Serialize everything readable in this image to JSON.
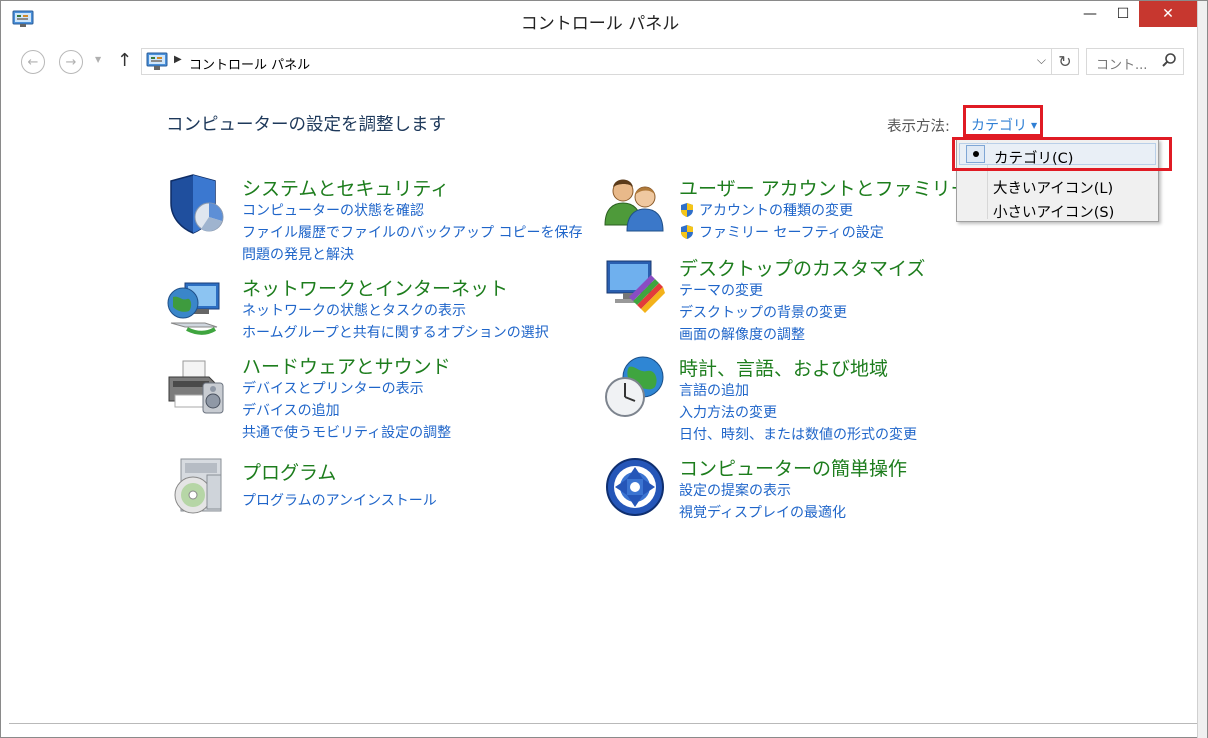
{
  "window": {
    "title": "コントロール パネル",
    "buttons": {
      "minimize": "—",
      "maximize": "☐",
      "close": "✕"
    }
  },
  "address_bar": {
    "path": "コントロール パネル",
    "search_placeholder": "コント..."
  },
  "main": {
    "title": "コンピューターの設定を調整します",
    "view_by_label": "表示方法:",
    "view_by_value": "カテゴリ"
  },
  "view_menu": {
    "items": [
      {
        "label": "カテゴリ(C)",
        "selected": true
      },
      {
        "label": "大きいアイコン(L)",
        "selected": false
      },
      {
        "label": "小さいアイコン(S)",
        "selected": false
      }
    ]
  },
  "categories": {
    "system": {
      "title": "システムとセキュリティ",
      "links": [
        "コンピューターの状態を確認",
        "ファイル履歴でファイルのバックアップ コピーを保存",
        "問題の発見と解決"
      ]
    },
    "network": {
      "title": "ネットワークとインターネット",
      "links": [
        "ネットワークの状態とタスクの表示",
        "ホームグループと共有に関するオプションの選択"
      ]
    },
    "hardware": {
      "title": "ハードウェアとサウンド",
      "links": [
        "デバイスとプリンターの表示",
        "デバイスの追加",
        "共通で使うモビリティ設定の調整"
      ]
    },
    "programs": {
      "title": "プログラム",
      "links": [
        "プログラムのアンインストール"
      ]
    },
    "users": {
      "title": "ユーザー アカウントとファミリー セーフ",
      "links": [
        "アカウントの種類の変更",
        "ファミリー セーフティの設定"
      ]
    },
    "appearance": {
      "title": "デスクトップのカスタマイズ",
      "links": [
        "テーマの変更",
        "デスクトップの背景の変更",
        "画面の解像度の調整"
      ]
    },
    "clock": {
      "title": "時計、言語、および地域",
      "links": [
        "言語の追加",
        "入力方法の変更",
        "日付、時刻、または数値の形式の変更"
      ]
    },
    "ease": {
      "title": "コンピューターの簡単操作",
      "links": [
        "設定の提案の表示",
        "視覚ディスプレイの最適化"
      ]
    }
  },
  "colors": {
    "category_title": "#1d7d1d",
    "link": "#1f65c9",
    "highlight_box": "#e01b24",
    "close_button": "#c7372f"
  }
}
